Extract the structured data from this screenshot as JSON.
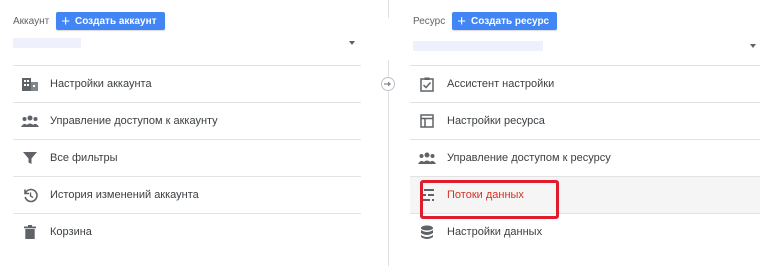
{
  "account": {
    "label": "Аккаунт",
    "create_button": "Создать аккаунт",
    "items": [
      {
        "label": "Настройки аккаунта",
        "icon": "building-icon"
      },
      {
        "label": "Управление доступом к аккаунту",
        "icon": "people-icon"
      },
      {
        "label": "Все фильтры",
        "icon": "filter-icon"
      },
      {
        "label": "История изменений аккаунта",
        "icon": "history-icon"
      },
      {
        "label": "Корзина",
        "icon": "trash-icon"
      }
    ]
  },
  "property": {
    "label": "Ресурс",
    "create_button": "Создать ресурс",
    "items": [
      {
        "label": "Ассистент настройки",
        "icon": "checkbox-icon"
      },
      {
        "label": "Настройки ресурса",
        "icon": "window-icon"
      },
      {
        "label": "Управление доступом к ресурсу",
        "icon": "people-icon"
      },
      {
        "label": "Потоки данных",
        "icon": "streams-icon"
      },
      {
        "label": "Настройки данных",
        "icon": "database-icon"
      }
    ]
  },
  "colors": {
    "accent": "#4285f4",
    "highlight_text": "#d93025",
    "highlight_border": "#e01b2b"
  }
}
